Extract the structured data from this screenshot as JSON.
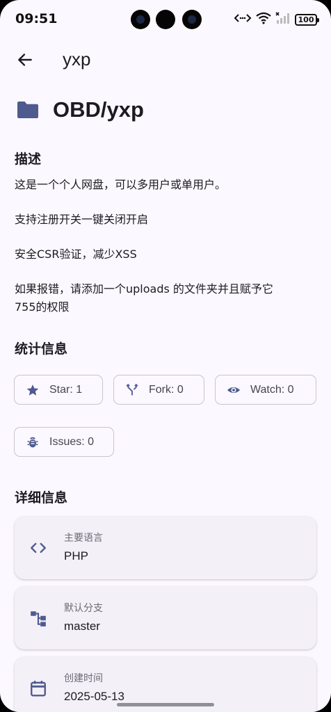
{
  "status_bar": {
    "time": "09:51",
    "battery": "100",
    "icons": [
      "code-icon",
      "wifi-icon",
      "signal-icon",
      "battery-icon"
    ]
  },
  "app_bar": {
    "title": "yxp",
    "back_icon": "arrow-back-icon"
  },
  "repo": {
    "full_name": "OBD/yxp",
    "icon": "folder-icon"
  },
  "description": {
    "title": "描述",
    "lines": [
      "这是一个个人网盘，可以多用户或单用户。",
      "支持注册开关一键关闭开启",
      "安全CSR验证，减少XSS",
      "如果报错，请添加一个uploads 的文件夹并且赋予它",
      "755的权限"
    ]
  },
  "stats": {
    "title": "统计信息",
    "items": [
      {
        "label": "Star: 1",
        "icon": "star-icon"
      },
      {
        "label": "Fork: 0",
        "icon": "fork-icon"
      },
      {
        "label": "Watch: 0",
        "icon": "eye-icon"
      },
      {
        "label": "Issues: 0",
        "icon": "bug-icon"
      }
    ]
  },
  "details": {
    "title": "详细信息",
    "items": [
      {
        "label": "主要语言",
        "value": "PHP",
        "icon": "code-icon"
      },
      {
        "label": "默认分支",
        "value": "master",
        "icon": "branch-icon"
      },
      {
        "label": "创建时间",
        "value": "2025-05-13",
        "icon": "calendar-icon"
      }
    ]
  },
  "colors": {
    "accent": "#4f5a8f",
    "background": "#fcf8ff",
    "card": "#f4f0f8",
    "chip_border": "#c7c5d0"
  }
}
